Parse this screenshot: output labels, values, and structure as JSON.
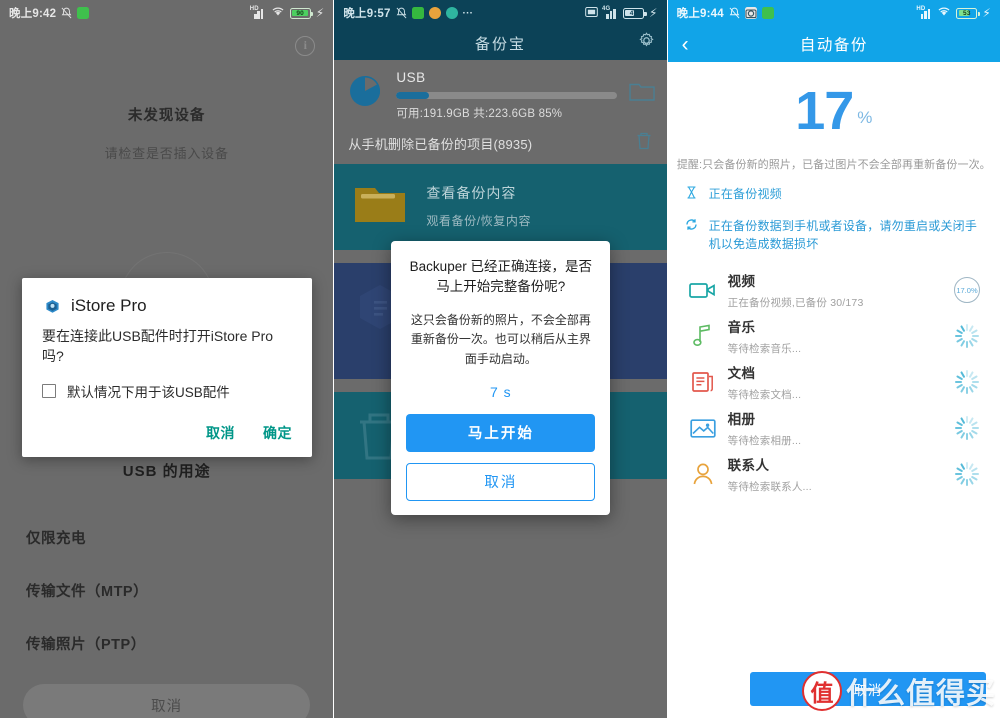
{
  "panels": {
    "left": {
      "statusbar": {
        "time": "晚上9:42",
        "bell_icon": "bell-muted-icon",
        "app_chip": "green-app-icon",
        "signal_icon": "signal-hd-icon",
        "wifi_icon": "wifi-icon",
        "battery_level": "90",
        "charging_icon": "bolt-icon"
      },
      "info_icon_label": "i",
      "empty_title": "未发现设备",
      "empty_subtitle": "请检查是否插入设备",
      "dialog": {
        "app_name": "iStore Pro",
        "message": "要在连接此USB配件时打开iStore Pro吗?",
        "checkbox_label": "默认情况下用于该USB配件",
        "checkbox_checked": false,
        "cancel": "取消",
        "confirm": "确定"
      },
      "usb_sheet": {
        "title": "USB 的用途",
        "options": [
          "仅限充电",
          "传输文件（MTP）",
          "传输照片（PTP）"
        ],
        "cancel": "取消"
      }
    },
    "middle": {
      "statusbar": {
        "time": "晚上9:57",
        "bell_icon": "bell-muted-icon",
        "chips": [
          "green-app-icon",
          "orange-app-icon",
          "teal-app-icon"
        ],
        "more": "···",
        "card_icon": "sim-card-icon",
        "signal_icon": "signal-4g-icon",
        "battery_level": "47",
        "charging_icon": "bolt-icon"
      },
      "appbar": {
        "title": "备份宝",
        "settings_icon": "gear-icon"
      },
      "usb": {
        "name": "USB",
        "progress_percent": 85,
        "capacity_text": "可用:191.9GB 共:223.6GB  85%",
        "folder_icon": "folder-icon",
        "delete_row_label": "从手机删除已备份的项目(8935)",
        "trash_icon": "trash-icon"
      },
      "cards": [
        {
          "icon": "folder-icon",
          "title": "查看备份内容",
          "subtitle": "观看备份/恢复内容",
          "theme": "teal"
        },
        {
          "icon": "device-icon",
          "title": "",
          "subtitle": "",
          "theme": "navy"
        },
        {
          "icon": "trash-icon",
          "title": "",
          "subtitle": "",
          "theme": "teal"
        }
      ],
      "dialog": {
        "heading": "Backuper 已经正确连接，是否马上开始完整备份呢?",
        "body": "这只会备份新的照片，不会全部再重新备份一次。也可以稍后从主界面手动启动。",
        "countdown": "7 s",
        "primary_button": "马上开始",
        "secondary_button": "取消"
      }
    },
    "right": {
      "statusbar": {
        "time": "晚上9:44",
        "bell_icon": "bell-muted-icon",
        "chips": [
          "camera-app-icon",
          "green-app-icon"
        ],
        "signal_icon": "signal-icon",
        "wifi_icon": "wifi-icon",
        "battery_level": "53",
        "charging_icon": "bolt-icon"
      },
      "appbar": {
        "back_icon": "chevron-left-icon",
        "title": "自动备份"
      },
      "progress": {
        "value": "17",
        "symbol": "%"
      },
      "hint": "提醒:只会备份新的照片，已备过图片不会全部再重新备份一次。",
      "notes": [
        {
          "icon": "hourglass-icon",
          "text": "正在备份视频"
        },
        {
          "icon": "sync-icon",
          "text": "正在备份数据到手机或者设备，请勿重启或关闭手机以免造成数据损坏"
        }
      ],
      "items": [
        {
          "icon": "video-icon",
          "color": "#1aa6a6",
          "name": "视频",
          "status": "正在备份视频,已备份 30/173",
          "indicator": "ring",
          "indicator_text": "17.0%"
        },
        {
          "icon": "music-icon",
          "color": "#5dbb63",
          "name": "音乐",
          "status": "等待检索音乐...",
          "indicator": "spinner",
          "indicator_text": ""
        },
        {
          "icon": "document-icon",
          "color": "#e2574c",
          "name": "文档",
          "status": "等待检索文档...",
          "indicator": "spinner",
          "indicator_text": ""
        },
        {
          "icon": "album-icon",
          "color": "#3a9fe0",
          "name": "相册",
          "status": "等待检索相册...",
          "indicator": "spinner",
          "indicator_text": ""
        },
        {
          "icon": "contacts-icon",
          "color": "#e8a33c",
          "name": "联系人",
          "status": "等待检索联系人...",
          "indicator": "spinner",
          "indicator_text": ""
        }
      ],
      "cancel_button": "取消"
    }
  },
  "watermark": {
    "badge": "值",
    "text": "什么值得买"
  },
  "colors": {
    "accent_blue": "#2196f3",
    "appbar_blue": "#11a4e8",
    "teal_dark": "#0c4257",
    "card_teal": "#15616f",
    "card_navy": "#2a3f6b",
    "gray_bg": "#6b6b6b",
    "dialog_action_teal": "#009688"
  }
}
